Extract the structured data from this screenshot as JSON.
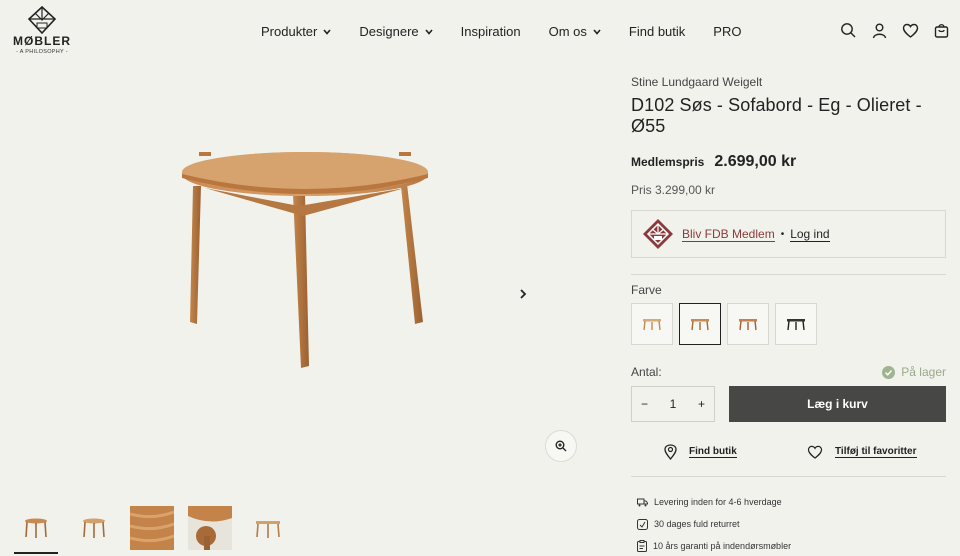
{
  "brand": {
    "name": "MØBLER",
    "tagline": "- A PHILOSOPHY -"
  },
  "nav": [
    {
      "label": "Produkter",
      "has_dropdown": true
    },
    {
      "label": "Designere",
      "has_dropdown": true
    },
    {
      "label": "Inspiration",
      "has_dropdown": false
    },
    {
      "label": "Om os",
      "has_dropdown": true
    },
    {
      "label": "Find butik",
      "has_dropdown": false
    },
    {
      "label": "PRO",
      "has_dropdown": false
    }
  ],
  "header_icons": [
    "search-icon",
    "account-icon",
    "heart-icon",
    "cart-icon"
  ],
  "product": {
    "designer": "Stine Lundgaard Weigelt",
    "title": "D102 Søs - Sofabord - Eg - Olieret - Ø55",
    "member_label": "Medlemspris",
    "member_price": "2.699,00 kr",
    "regular_price": "Pris 3.299,00 kr"
  },
  "fdb": {
    "join_label": "Bliv FDB Medlem",
    "separator": "•",
    "login_label": "Log ind"
  },
  "color": {
    "label": "Farve",
    "swatches": [
      {
        "name": "oak-light",
        "color": "#d9a877",
        "selected": false
      },
      {
        "name": "oak-oiled",
        "color": "#c98b55",
        "selected": true
      },
      {
        "name": "oak-warm",
        "color": "#c77f52",
        "selected": false
      },
      {
        "name": "black",
        "color": "#333333",
        "selected": false
      }
    ]
  },
  "quantity": {
    "label": "Antal:",
    "value": "1",
    "minus": "−",
    "plus": "+"
  },
  "stock": {
    "label": "På lager"
  },
  "add_to_cart": "Læg i kurv",
  "actions": {
    "find_store": "Find butik",
    "add_favorite": "Tilføj til favoritter"
  },
  "usps": [
    {
      "icon": "truck-icon",
      "text": "Levering inden for 4-6 hverdage"
    },
    {
      "icon": "return-icon",
      "text": "30 dages fuld returret"
    },
    {
      "icon": "clipboard-icon",
      "text": "10 års garanti på indendørsmøbler"
    }
  ],
  "colors": {
    "accent": "#474746",
    "fdb_red": "#8a3a3a",
    "stock_green": "#98a98a",
    "background": "#f2f2ed"
  }
}
